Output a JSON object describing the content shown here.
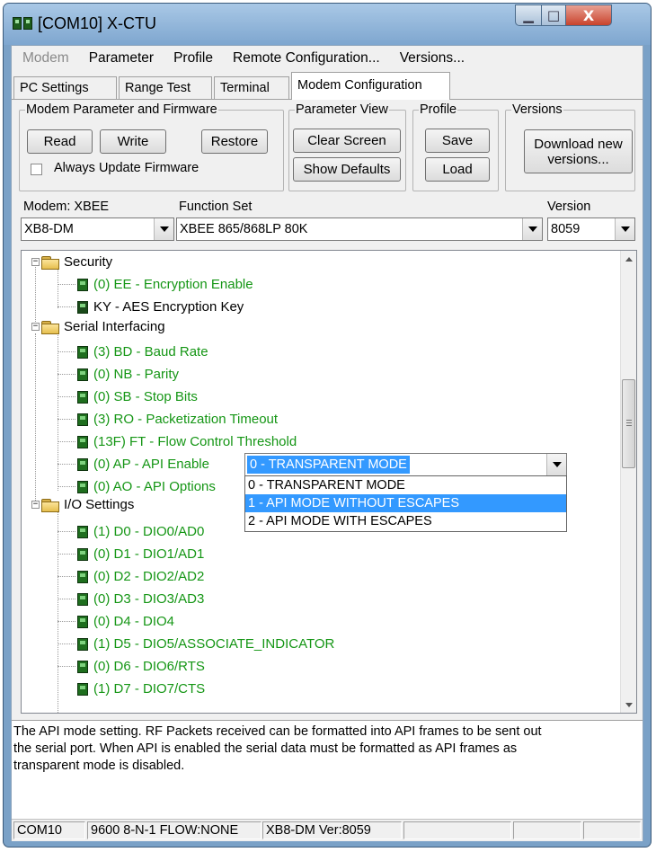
{
  "window": {
    "title": "[COM10] X-CTU",
    "minimize": "▁",
    "maximize": "□",
    "close": "X"
  },
  "menu": [
    "Modem",
    "Parameter",
    "Profile",
    "Remote Configuration...",
    "Versions..."
  ],
  "tabs": [
    "PC Settings",
    "Range Test",
    "Terminal",
    "Modem Configuration"
  ],
  "groups": {
    "firmware": {
      "legend": "Modem Parameter and Firmware",
      "read": "Read",
      "write": "Write",
      "restore": "Restore",
      "always_update": "Always Update Firmware"
    },
    "view": {
      "legend": "Parameter View",
      "clear": "Clear Screen",
      "defaults": "Show Defaults"
    },
    "profile": {
      "legend": "Profile",
      "save": "Save",
      "load": "Load"
    },
    "versions": {
      "legend": "Versions",
      "download_line1": "Download new",
      "download_line2": "versions..."
    }
  },
  "modem": {
    "modem_label": "Modem: XBEE",
    "modem_value": "XB8-DM",
    "function_label": "Function Set",
    "function_value": "XBEE 865/868LP 80K",
    "version_label": "Version",
    "version_value": "8059"
  },
  "tree": {
    "security": "Security",
    "ee": "(0) EE - Encryption Enable",
    "ky": "KY - AES Encryption Key",
    "serial": "Serial Interfacing",
    "bd": "(3) BD - Baud Rate",
    "nb": "(0) NB - Parity",
    "sb": "(0) SB - Stop Bits",
    "ro": "(3) RO - Packetization Timeout",
    "ft": "(13F) FT - Flow Control Threshold",
    "ap": "(0) AP - API Enable",
    "ao": "(0) AO - API Options",
    "io": "I/O Settings",
    "d0": "(1) D0 - DIO0/AD0",
    "d1": "(0) D1 - DIO1/AD1",
    "d2": "(0) D2 - DIO2/AD2",
    "d3": "(0) D3 - DIO3/AD3",
    "d4": "(0) D4 - DIO4",
    "d5": "(1) D5 - DIO5/ASSOCIATE_INDICATOR",
    "d6": "(0) D6 - DIO6/RTS",
    "d7": "(1) D7 - DIO7/CTS"
  },
  "api_combo": {
    "selected": "0 - TRANSPARENT MODE",
    "options": [
      "0 - TRANSPARENT MODE",
      "1 - API MODE WITHOUT ESCAPES",
      "2 - API MODE WITH ESCAPES"
    ]
  },
  "description": {
    "line1": "The API mode setting. RF Packets received can be formatted into API frames to be sent out",
    "line2": "the serial port. When API is enabled the serial data must be formatted as API frames as",
    "line3": "transparent mode is disabled."
  },
  "status": {
    "port": "COM10",
    "settings": "9600 8-N-1  FLOW:NONE",
    "modem": "XB8-DM  Ver:8059"
  },
  "colors": {
    "param_green": "#159615",
    "selection": "#3399ff",
    "title_bar": "#7ea6cf"
  },
  "icons": [
    "app-icon",
    "minimize-icon",
    "maximize-icon",
    "close-icon",
    "folder-icon",
    "parameter-icon",
    "chevron-down-icon",
    "scroll-up-icon",
    "scroll-down-icon"
  ]
}
